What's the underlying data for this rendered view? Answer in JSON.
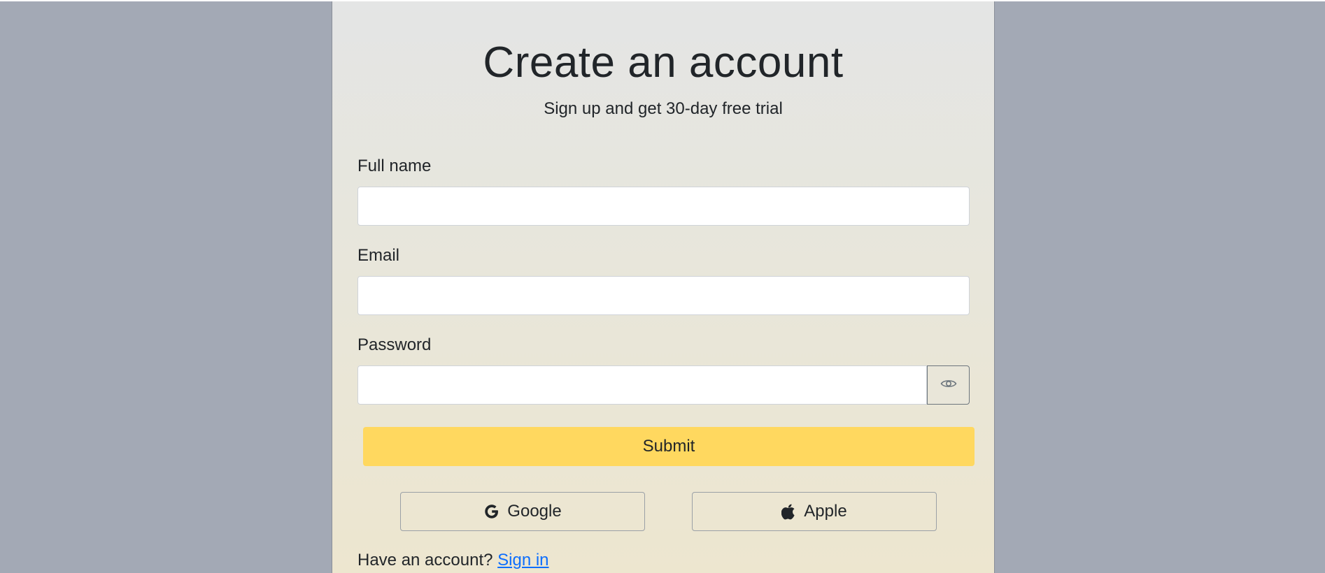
{
  "page": {
    "title": "Create an account",
    "subtitle": "Sign up and get 30-day free trial"
  },
  "form": {
    "full_name": {
      "label": "Full name",
      "value": "",
      "placeholder": ""
    },
    "email": {
      "label": "Email",
      "value": "",
      "placeholder": ""
    },
    "password": {
      "label": "Password",
      "value": "",
      "placeholder": "",
      "toggle_icon": "eye-icon"
    },
    "submit_label": "Submit"
  },
  "social": {
    "google": {
      "label": "Google",
      "icon": "google-icon"
    },
    "apple": {
      "label": "Apple",
      "icon": "apple-icon"
    }
  },
  "footer": {
    "prompt": "Have an account?",
    "link": "Sign in"
  },
  "colors": {
    "background": "#a3a9b5",
    "submit": "#ffd85f",
    "link": "#0d6efd",
    "text": "#212529"
  }
}
